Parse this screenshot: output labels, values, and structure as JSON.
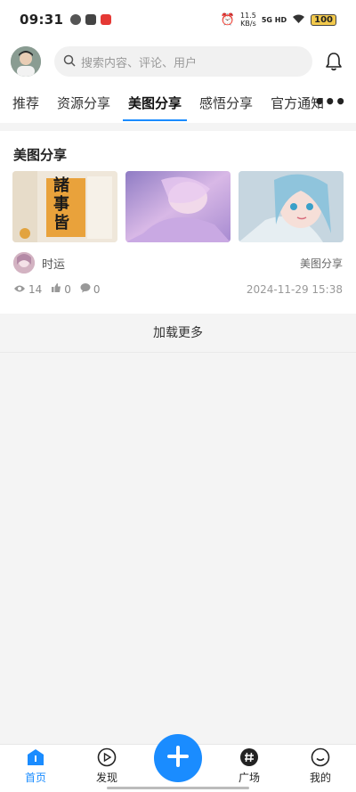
{
  "status_bar": {
    "time": "09:31",
    "net_speed_value": "11.5",
    "net_speed_unit": "KB/s",
    "network": "5G HD",
    "battery": "100"
  },
  "header": {
    "search_placeholder": "搜索内容、评论、用户"
  },
  "tabs": [
    {
      "label": "推荐"
    },
    {
      "label": "资源分享"
    },
    {
      "label": "美图分享",
      "active": true
    },
    {
      "label": "感悟分享"
    },
    {
      "label": "官方通知"
    }
  ],
  "more_label": "•••",
  "post": {
    "title": "美图分享",
    "author": "时运",
    "category": "美图分享",
    "views": "14",
    "likes": "0",
    "comments": "0",
    "date": "2024-11-29 15:38",
    "thumb1_text": "諸事皆"
  },
  "load_more": "加载更多",
  "nav": {
    "home": "首页",
    "discover": "发现",
    "square": "广场",
    "mine": "我的"
  },
  "colors": {
    "accent": "#1a8cff"
  }
}
